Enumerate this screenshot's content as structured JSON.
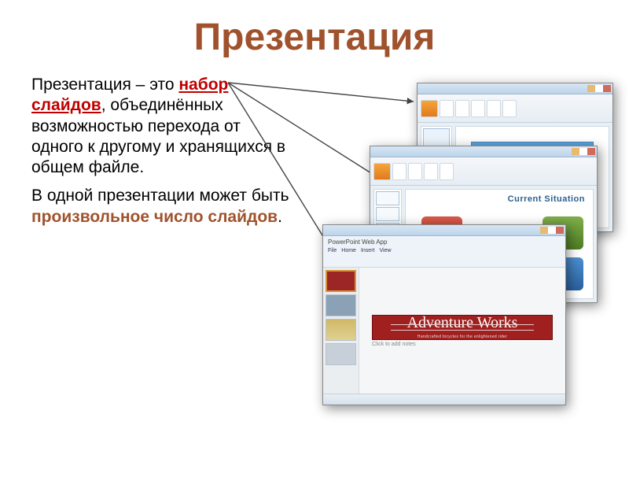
{
  "title": "Презентация",
  "para1": {
    "pre": "Презентация – это ",
    "h": "набор слайдов",
    "post": ", объединённых возможностью перехода от одного к другому и хранящихся в общем файле."
  },
  "para2": {
    "pre": "В одной презентации может быть ",
    "h": "произвольное число слайдов",
    "post": "."
  },
  "screenshots": {
    "win2_title": "Current Situation",
    "win3_toolbar": "PowerPoint Web App",
    "win3_slide_title": "Adventure Works",
    "win3_slide_sub": "Handcrafted bicycles for the enlightened rider",
    "win3_addtext": "Click to add notes"
  }
}
